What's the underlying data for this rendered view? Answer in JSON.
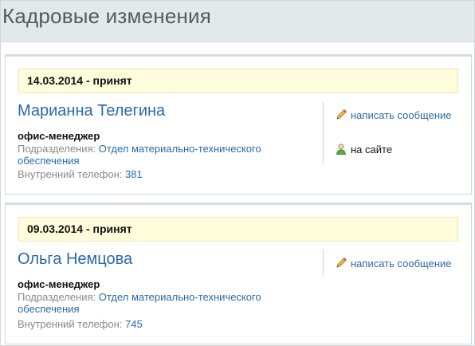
{
  "page": {
    "title": "Кадровые изменения"
  },
  "entries": [
    {
      "event": "14.03.2014 - принят",
      "name": "Марианна Телегина",
      "position": "офис-менеджер",
      "dept_label": "Подразделения:",
      "dept_value": "Отдел материально-технического обеспечения",
      "phone_label": "Внутренний телефон:",
      "phone_value": "381",
      "message_label": "написать сообщение",
      "status_label": "на сайте"
    },
    {
      "event": "09.03.2014 - принят",
      "name": "Ольга Немцова",
      "position": "офис-менеджер",
      "dept_label": "Подразделения:",
      "dept_value": "Отдел материально-технического обеспечения",
      "phone_label": "Внутренний телефон:",
      "phone_value": "745",
      "message_label": "написать сообщение"
    }
  ],
  "colors": {
    "link": "#2a6aaa",
    "event_bar": "#fffcdb",
    "header_bg": "#e3e9eb"
  },
  "icons": {
    "message": "pencil-icon",
    "status": "user-online-icon"
  }
}
